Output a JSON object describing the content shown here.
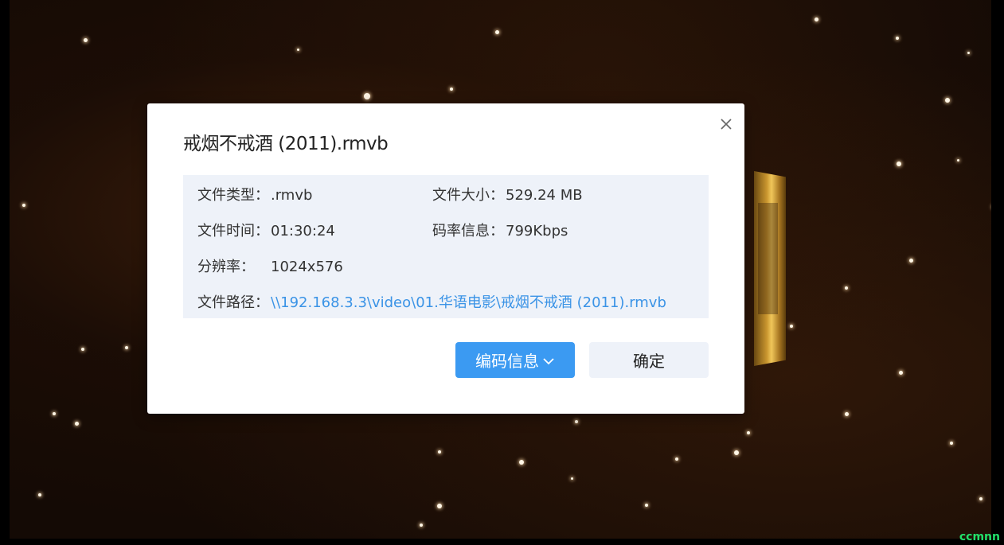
{
  "dialog": {
    "title": "戒烟不戒酒 (2011).rmvb",
    "close_icon": "close-icon",
    "info": {
      "file_type_label": "文件类型：",
      "file_type_value": ".rmvb",
      "file_size_label": "文件大小：",
      "file_size_value": "529.24 MB",
      "file_time_label": "文件时间：",
      "file_time_value": "01:30:24",
      "bitrate_label": "码率信息：",
      "bitrate_value": "799Kbps",
      "resolution_label": "分辨率：",
      "resolution_value": "1024x576",
      "path_label": "文件路径：",
      "path_value": "\\\\192.168.3.3\\video\\01.华语电影\\戒烟不戒酒 (2011).rmvb"
    },
    "buttons": {
      "encode_info_label": "编码信息",
      "encode_info_icon": "chevron-down-icon",
      "confirm_label": "确定"
    }
  },
  "watermark": "ccmnn",
  "colors": {
    "primary": "#3b9af2",
    "link": "#3a93e6",
    "info_bg": "#eef2f9",
    "watermark": "#22e06a"
  }
}
